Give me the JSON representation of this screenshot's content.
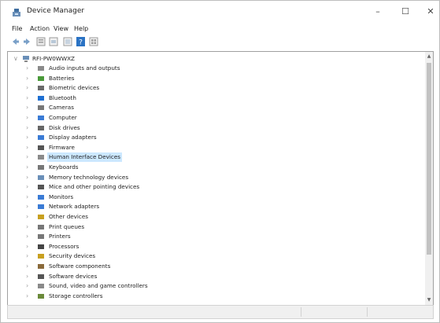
{
  "window": {
    "title": "Device Manager",
    "minimize": "–",
    "maximize": "☐",
    "close": "✕"
  },
  "menu": [
    "File",
    "Action",
    "View",
    "Help"
  ],
  "toolbar": {
    "buttons": [
      "back-icon",
      "forward-icon",
      "properties-icon",
      "show-hide-icon",
      "help-icon",
      "grid-icon"
    ]
  },
  "tree": {
    "root": "RFI-PW0WWXZ",
    "items": [
      {
        "label": "Audio inputs and outputs",
        "icon": "audio-icon"
      },
      {
        "label": "Batteries",
        "icon": "battery-icon"
      },
      {
        "label": "Biometric devices",
        "icon": "biometric-icon"
      },
      {
        "label": "Bluetooth",
        "icon": "bluetooth-icon"
      },
      {
        "label": "Cameras",
        "icon": "camera-icon"
      },
      {
        "label": "Computer",
        "icon": "computer-icon"
      },
      {
        "label": "Disk drives",
        "icon": "disk-icon"
      },
      {
        "label": "Display adapters",
        "icon": "display-icon"
      },
      {
        "label": "Firmware",
        "icon": "firmware-icon"
      },
      {
        "label": "Human Interface Devices",
        "icon": "hid-icon",
        "selected": true
      },
      {
        "label": "Keyboards",
        "icon": "keyboard-icon"
      },
      {
        "label": "Memory technology devices",
        "icon": "memory-icon"
      },
      {
        "label": "Mice and other pointing devices",
        "icon": "mouse-icon"
      },
      {
        "label": "Monitors",
        "icon": "monitor-icon"
      },
      {
        "label": "Network adapters",
        "icon": "network-icon"
      },
      {
        "label": "Other devices",
        "icon": "other-icon"
      },
      {
        "label": "Print queues",
        "icon": "printer-icon"
      },
      {
        "label": "Printers",
        "icon": "printer-icon"
      },
      {
        "label": "Processors",
        "icon": "processor-icon"
      },
      {
        "label": "Security devices",
        "icon": "security-icon"
      },
      {
        "label": "Software components",
        "icon": "software-icon"
      },
      {
        "label": "Software devices",
        "icon": "software-device-icon"
      },
      {
        "label": "Sound, video and game controllers",
        "icon": "sound-icon"
      },
      {
        "label": "Storage controllers",
        "icon": "storage-icon"
      }
    ]
  },
  "colors": {
    "selection": "#cce8ff",
    "accent": "#1e78d2"
  }
}
